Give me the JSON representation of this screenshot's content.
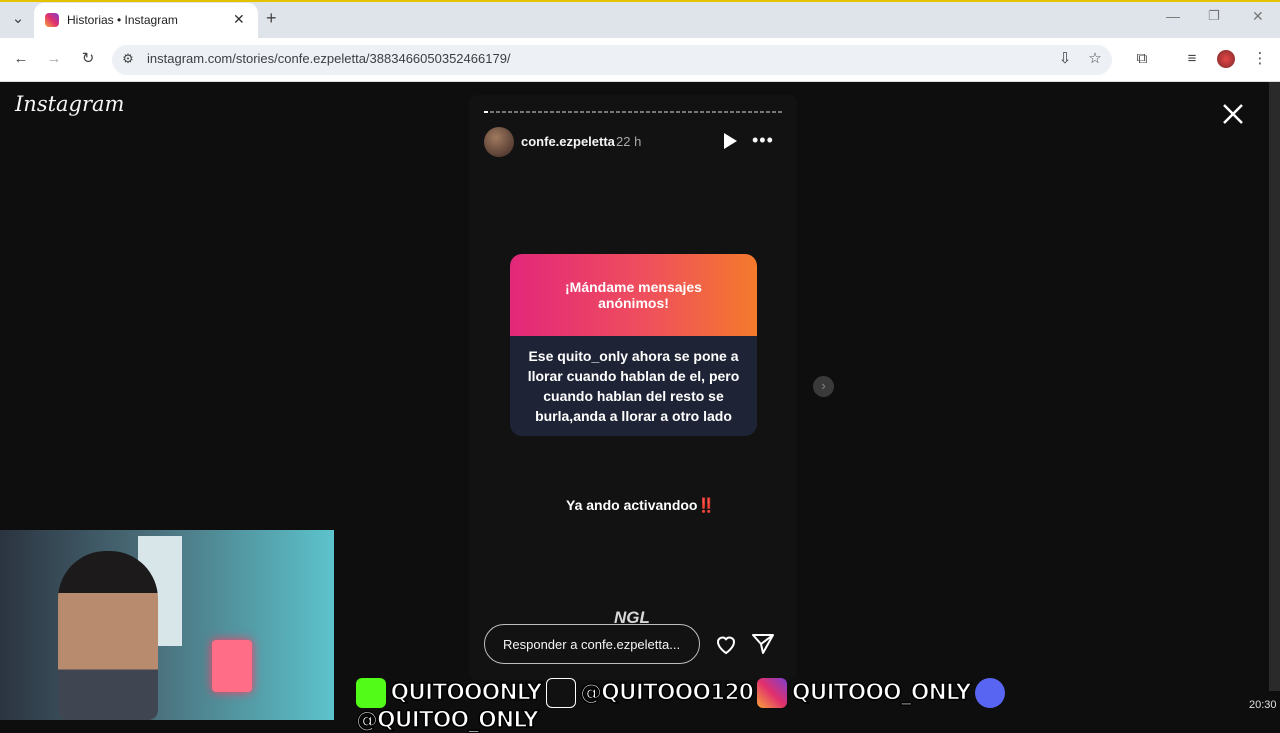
{
  "browser": {
    "tab_title": "Historias • Instagram",
    "url": "instagram.com/stories/confe.ezpeletta/3883466050352466179/"
  },
  "story": {
    "brand": "Instagram",
    "username": "confe.ezpeletta",
    "time_ago": "22 h",
    "card_header": "¡Mándame mensajes anónimos!",
    "card_body": "Ese quito_only ahora se pone a llorar cuando hablan de el, pero cuando hablan del resto se burla,anda a llorar a otro lado",
    "caption": "Ya ando activandoo‼️",
    "ngl_label": "NGL",
    "reply_placeholder": "Responder a confe.ezpeletta..."
  },
  "colors": {
    "card_gradient_start": "#e3277a",
    "card_gradient_end": "#f47a2c",
    "card_body_bg": "#1e2336",
    "page_bg": "#0e0e0e"
  },
  "stream_overlay": {
    "kick": "QUITOOONLY",
    "tiktok": "@QUITOOO120",
    "instagram": "QUITOOO_ONLY",
    "discord": "@QUITOO_ONLY",
    "clock": "20:30"
  },
  "icons": {
    "tab_dropdown": "chevron-down-icon",
    "back": "arrow-left-icon",
    "forward": "arrow-right-icon",
    "reload": "reload-icon",
    "site_info": "tune-icon",
    "install": "install-icon",
    "bookmark": "star-icon",
    "extensions": "puzzle-icon",
    "media": "media-queue-icon",
    "profile": "avatar-icon",
    "menu": "kebab-icon"
  }
}
